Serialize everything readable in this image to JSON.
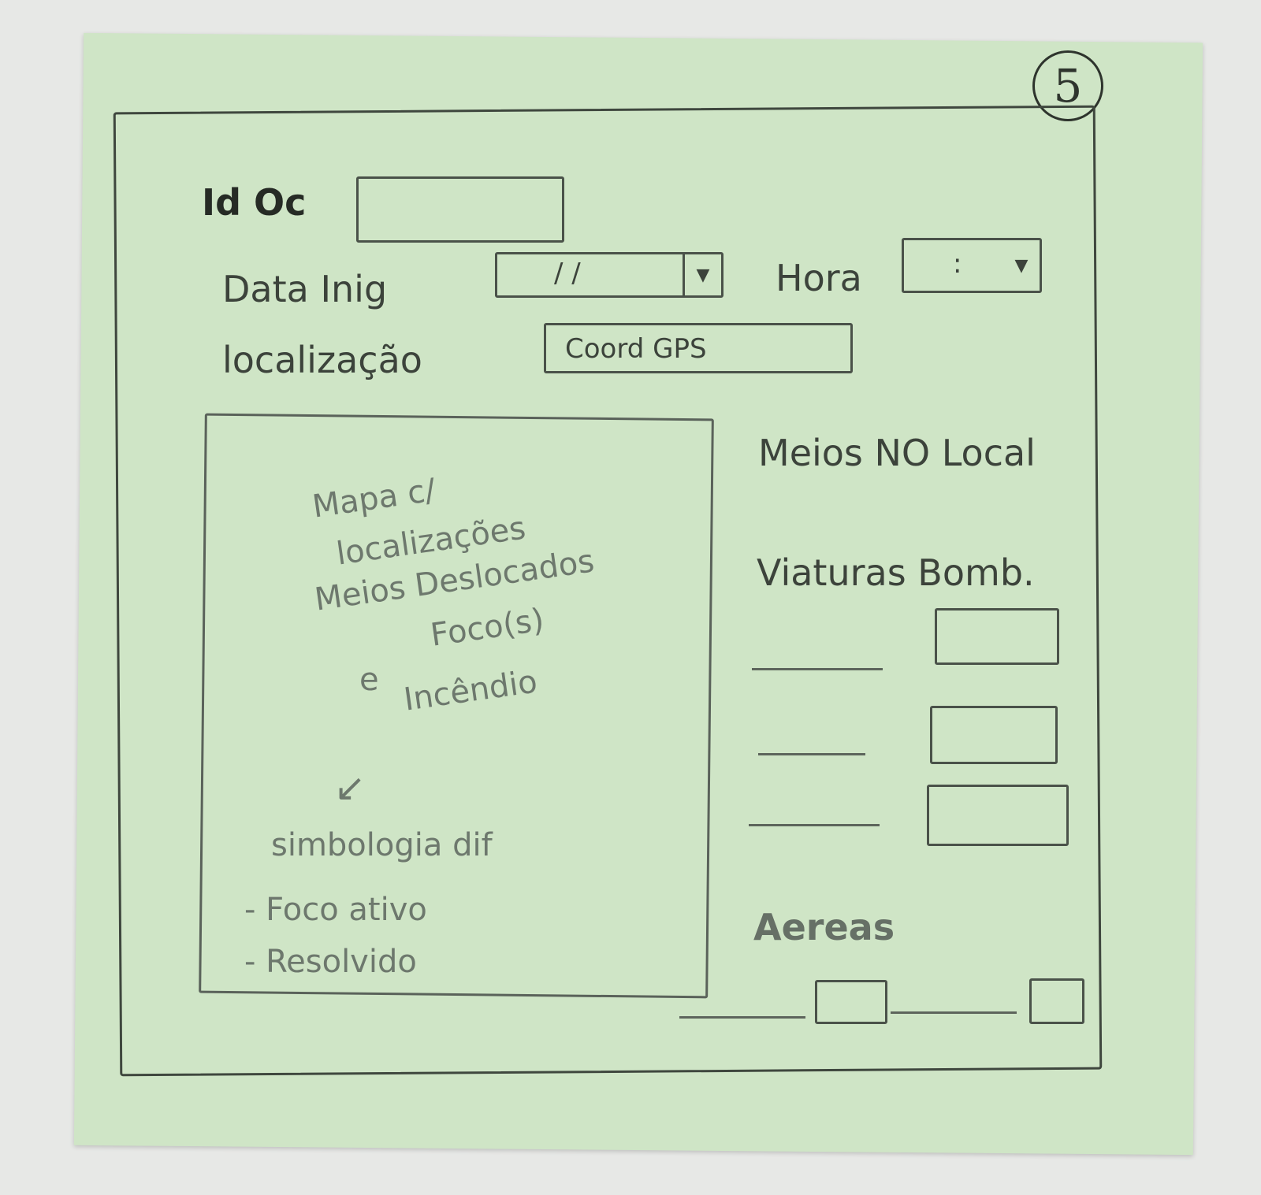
{
  "page_number": "5",
  "form": {
    "id_label": "Id Oc",
    "id_value": "",
    "date_label": "Data Inig",
    "date_value": "/ /",
    "time_label": "Hora",
    "time_value": ":",
    "location_label": "localização",
    "location_value": "Coord GPS"
  },
  "map": {
    "lines": [
      "Mapa c/",
      "localizações",
      "Meios Deslocados",
      "Foco(s)",
      "e",
      "Incêndio"
    ],
    "legend_title": "simbologia dif",
    "legend_items": [
      "- Foco ativo",
      "- Resolvido"
    ]
  },
  "resources": {
    "title": "Meios NO Local",
    "vehicles_label": "Viaturas Bomb.",
    "vehicle_rows": [
      {
        "name": "",
        "value": ""
      },
      {
        "name": "",
        "value": ""
      },
      {
        "name": "",
        "value": ""
      }
    ],
    "aerial_label": "Aereas",
    "aerial_rows": [
      {
        "name": "",
        "value": ""
      },
      {
        "name": "",
        "value": ""
      }
    ]
  }
}
